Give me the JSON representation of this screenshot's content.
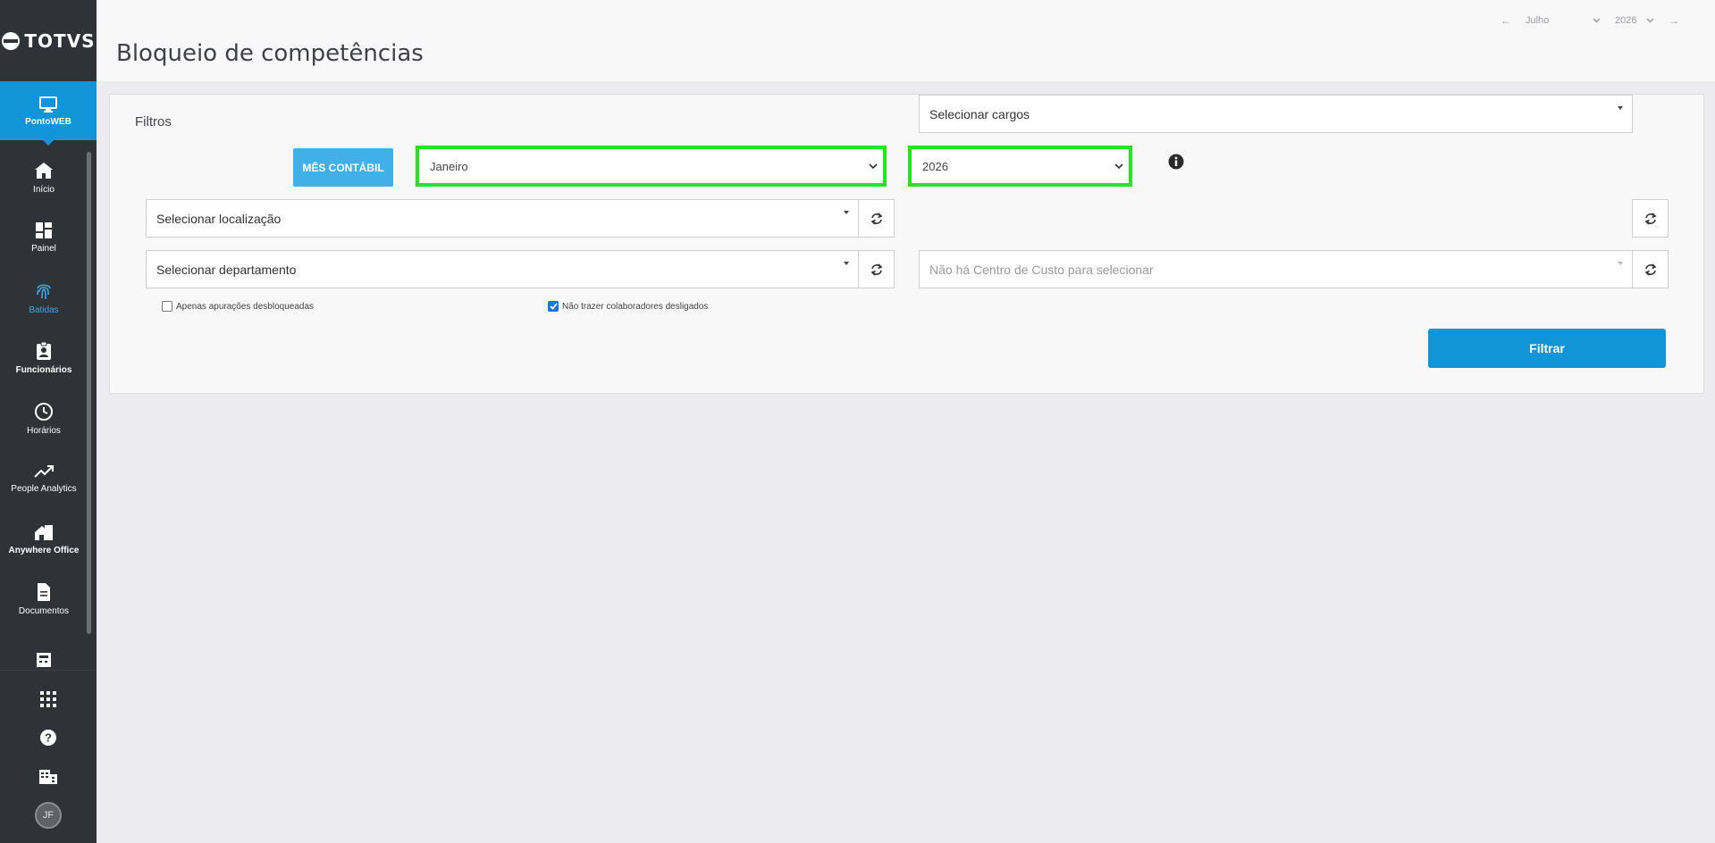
{
  "brand": {
    "name": "TOTVS"
  },
  "module": {
    "label": "PontoWEB"
  },
  "sidebar": {
    "items": [
      {
        "label": "Início",
        "icon": "home-icon"
      },
      {
        "label": "Painel",
        "icon": "dashboard-icon"
      },
      {
        "label": "Batidas",
        "icon": "fingerprint-icon"
      },
      {
        "label": "Funcionários",
        "icon": "badge-icon"
      },
      {
        "label": "Horários",
        "icon": "clock-icon"
      },
      {
        "label": "People Analytics",
        "icon": "trending-icon"
      },
      {
        "label": "Anywhere Office",
        "icon": "home-office-icon"
      },
      {
        "label": "Documentos",
        "icon": "document-icon"
      }
    ]
  },
  "user": {
    "initials": "JF"
  },
  "header": {
    "title": "Bloqueio de competências",
    "period": {
      "month": "Julho",
      "year": "2026"
    }
  },
  "filters": {
    "title": "Filtros",
    "mes_contabil_label": "MÊS CONTÁBIL",
    "month_select": "Janeiro",
    "year_select": "2026",
    "localizacao": "Selecionar localização",
    "cargos": "Selecionar cargos",
    "departamento": "Selecionar departamento",
    "centro_custo": "Não há Centro de Custo para selecionar",
    "chk_desbloqueadas": "Apenas apurações desbloqueadas",
    "chk_desligados": "Não trazer colaboradores desligados",
    "filtrar_label": "Filtrar"
  },
  "colors": {
    "accent": "#1194d8",
    "highlight": "#22e622",
    "sidebar": "#2f3237"
  }
}
